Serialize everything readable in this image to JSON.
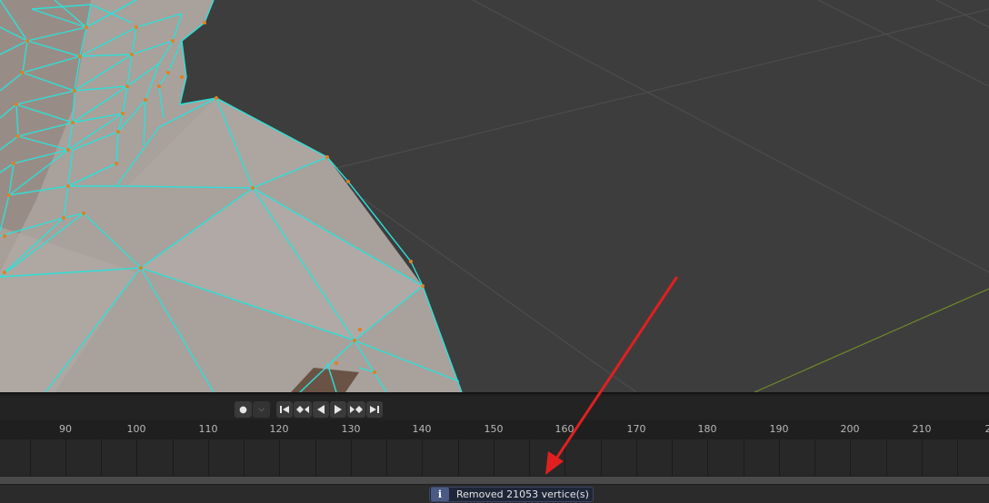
{
  "viewport": {
    "background": "#3d3d3d",
    "mesh_fill": "#a8a19c",
    "wire_color": "#2de0d8",
    "vertex_color": "#e08020",
    "grid_color": "#4f4f4f",
    "axis_y_color": "#6f8a2a"
  },
  "timeline": {
    "controls": [
      {
        "name": "record-icon",
        "glyph": "●"
      },
      {
        "name": "keying-dropdown-icon",
        "glyph": "⌵"
      },
      {
        "name": "jump-start-icon",
        "glyph": "⏮"
      },
      {
        "name": "prev-keyframe-icon",
        "glyph": "◆"
      },
      {
        "name": "play-reverse-icon",
        "glyph": "◀"
      },
      {
        "name": "play-icon",
        "glyph": "▶"
      },
      {
        "name": "next-keyframe-icon",
        "glyph": "◆"
      },
      {
        "name": "jump-end-icon",
        "glyph": "⏭"
      }
    ],
    "frame_labels": [
      "90",
      "100",
      "110",
      "120",
      "130",
      "140",
      "150",
      "160",
      "170",
      "180",
      "190",
      "200",
      "210",
      "2"
    ]
  },
  "status": {
    "report_icon": "i",
    "report_text": "Removed 21053 vertice(s)"
  },
  "annotation": {
    "arrow_color": "#e02020"
  }
}
